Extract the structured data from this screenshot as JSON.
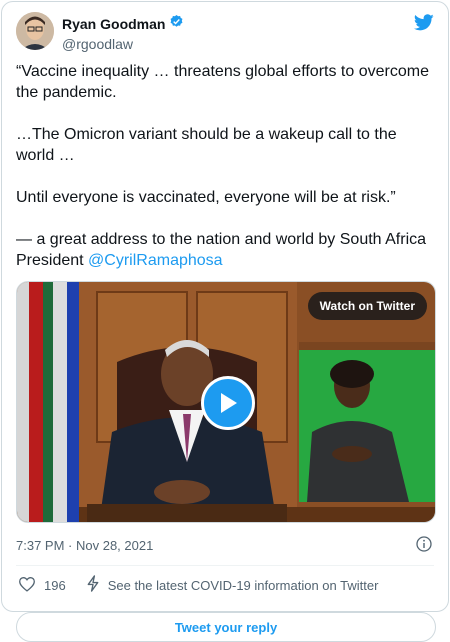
{
  "author": {
    "display_name": "Ryan Goodman",
    "handle": "@rgoodlaw",
    "verified_icon": "verified-badge-icon",
    "avatar_icon": "avatar-photo"
  },
  "brand": {
    "logo_icon": "twitter-bird-icon",
    "accent": "#1d9bf0"
  },
  "tweet": {
    "p1": "“Vaccine inequality … threatens global efforts to overcome the pandemic.",
    "p2": "…The Omicron variant should be a wakeup call to the world …",
    "p3": "Until everyone is vaccinated, everyone will be at risk.”",
    "p4_prefix": "— a great address to the nation and world by South Africa President ",
    "mention": "@CyrilRamaphosa"
  },
  "media": {
    "watch_label": "Watch on Twitter",
    "play_icon": "play-icon"
  },
  "meta": {
    "time": "7:37 PM",
    "separator": " · ",
    "date": "Nov 28, 2021",
    "info_icon": "info-icon"
  },
  "actions": {
    "like_icon": "heart-icon",
    "like_count": "196",
    "covid_icon": "lightning-icon",
    "covid_text": "See the latest COVID-19 information on Twitter"
  },
  "reply": {
    "label": "Tweet your reply"
  }
}
